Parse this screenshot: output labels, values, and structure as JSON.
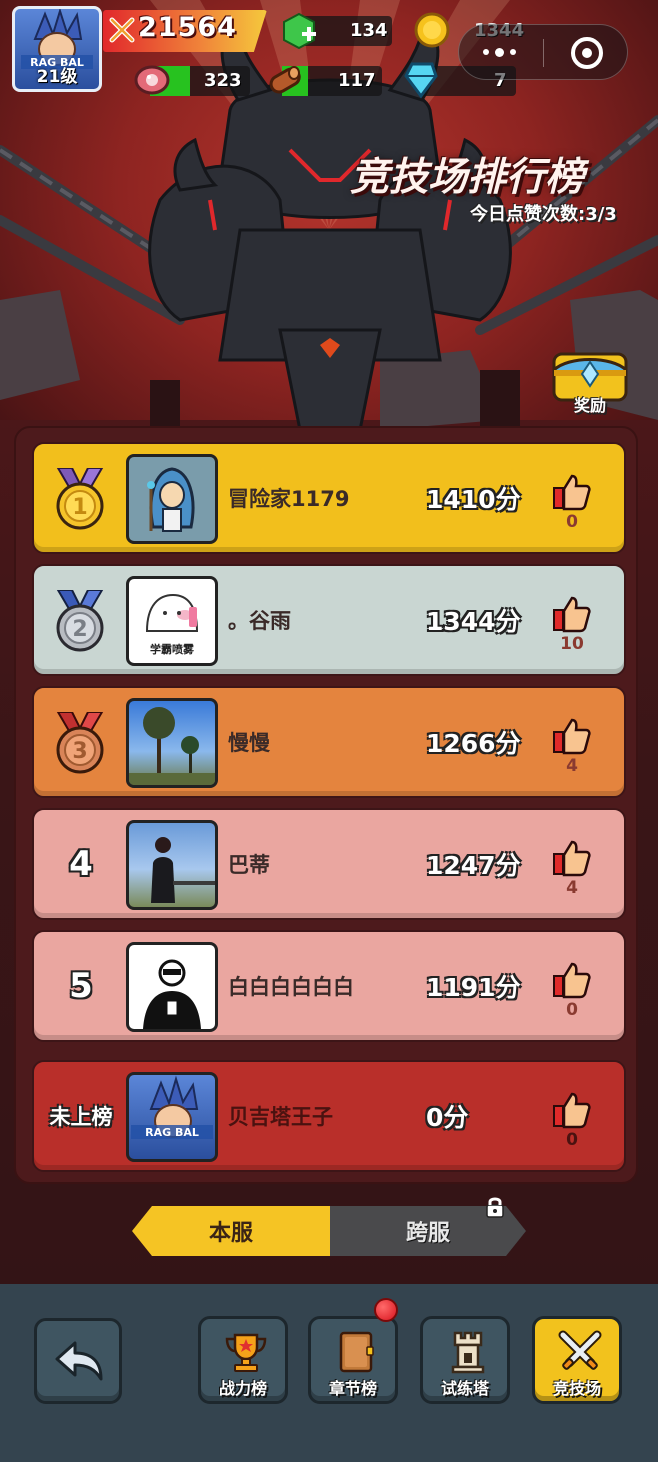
{
  "hud": {
    "level": "21级",
    "power": "21564",
    "gems": "134",
    "coins": "1344",
    "meat": "323",
    "wood": "117",
    "crystal": "7"
  },
  "header": {
    "title": "竞技场排行榜",
    "likes_today": "今日点赞次数:3/3"
  },
  "reward": {
    "label": "奖励"
  },
  "rankings": [
    {
      "rank": "1",
      "name": "冒险家1179",
      "score": "1410分",
      "likes": "0",
      "bg": "#f2bf1c"
    },
    {
      "rank": "2",
      "name": "。谷雨",
      "score": "1344分",
      "likes": "10",
      "avatar_text": "学霸喷雾",
      "bg": "#c9d6d2"
    },
    {
      "rank": "3",
      "name": "慢慢",
      "score": "1266分",
      "likes": "4",
      "bg": "#e4843e"
    },
    {
      "rank": "4",
      "name": "巴蒂",
      "score": "1247分",
      "likes": "4",
      "bg": "#eaa6a0"
    },
    {
      "rank": "5",
      "name": "白白白白白白",
      "score": "1191分",
      "likes": "0",
      "bg": "#eaa6a0"
    },
    {
      "rank": "未上榜",
      "name": "贝吉塔王子",
      "score": "0分",
      "likes": "0",
      "bg": "#b92f2a"
    }
  ],
  "tabs": {
    "local": "本服",
    "cross": "跨服"
  },
  "nav": {
    "power_rank": "战力榜",
    "chapter_rank": "章节榜",
    "tower": "试练塔",
    "arena": "竞技场"
  },
  "colors": {
    "accent": "#f2c21d",
    "nav_bg": "#34444f",
    "panel": "#4d1a1c"
  }
}
